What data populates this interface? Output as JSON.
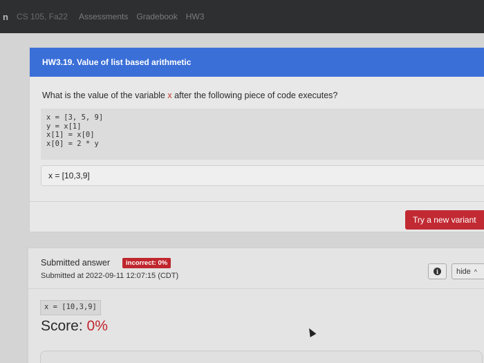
{
  "nav": {
    "brand": "n",
    "course": "CS 105, Fa22",
    "links": [
      "Assessments",
      "Gradebook",
      "HW3"
    ]
  },
  "question": {
    "header": "HW3.19. Value of list based arithmetic",
    "prompt_before": "What is the value of the variable ",
    "prompt_var": "x",
    "prompt_after": " after the following piece of code executes?",
    "code_lines": [
      "x = [3, 5, 9]",
      "y = x[1]",
      "x[1] = x[0]",
      "x[0] = 2 * y"
    ],
    "answer_value": "x = [10,3,9]",
    "help_icon": "?",
    "variant_button": "Try a new variant"
  },
  "submission": {
    "title": "Submitted answer",
    "badge": "incorrect: 0%",
    "timestamp": "Submitted at 2022-09-11 12:07:15 (CDT)",
    "info_icon": "i",
    "hide_label": "hide",
    "hide_chevron": "^",
    "answer_code": "x = [10,3,9]",
    "score_label": "Score: ",
    "score_value": "0%"
  },
  "colors": {
    "header": "#3a6fd8",
    "danger": "#c0262d",
    "nav_bg": "#2e2f31"
  }
}
